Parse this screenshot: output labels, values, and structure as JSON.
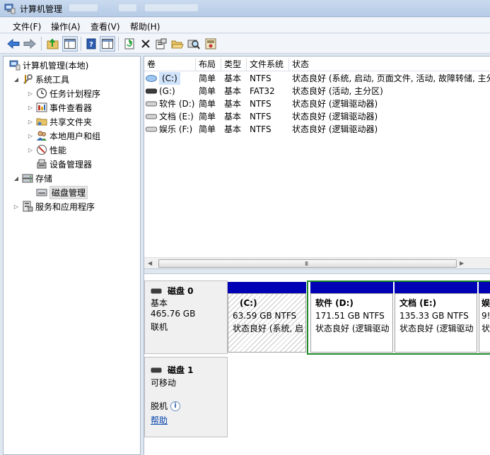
{
  "window": {
    "title": "计算机管理"
  },
  "menu": [
    {
      "label": "文件(F)"
    },
    {
      "label": "操作(A)"
    },
    {
      "label": "查看(V)"
    },
    {
      "label": "帮助(H)"
    }
  ],
  "toolbar": {
    "icons": [
      "back-arrow-icon",
      "forward-arrow-icon",
      "up-folder-icon",
      "show-hide-tree-icon",
      "help-book-icon",
      "show-hide-action-pane-icon",
      "refresh-icon",
      "delete-x-icon",
      "properties-icon",
      "open-folder-icon",
      "search-drive-icon",
      "disk-properties-icon"
    ]
  },
  "tree": {
    "root": "计算机管理(本地)",
    "system_tools": "系统工具",
    "task_scheduler": "任务计划程序",
    "event_viewer": "事件查看器",
    "shared_folders": "共享文件夹",
    "local_users": "本地用户和组",
    "performance": "性能",
    "device_manager": "设备管理器",
    "storage": "存储",
    "disk_management": "磁盘管理",
    "services_apps": "服务和应用程序"
  },
  "volumes": {
    "headers": [
      "卷",
      "布局",
      "类型",
      "文件系统",
      "状态"
    ],
    "rows": [
      {
        "name": "(C:)",
        "layout": "简单",
        "type": "基本",
        "fs": "NTFS",
        "status": "状态良好 (系统, 启动, 页面文件, 活动, 故障转储, 主分"
      },
      {
        "name": "(G:)",
        "layout": "简单",
        "type": "基本",
        "fs": "FAT32",
        "status": "状态良好 (活动, 主分区)"
      },
      {
        "name": "软件 (D:)",
        "layout": "简单",
        "type": "基本",
        "fs": "NTFS",
        "status": "状态良好 (逻辑驱动器)"
      },
      {
        "name": "文档 (E:)",
        "layout": "简单",
        "type": "基本",
        "fs": "NTFS",
        "status": "状态良好 (逻辑驱动器)"
      },
      {
        "name": "娱乐 (F:)",
        "layout": "简单",
        "type": "基本",
        "fs": "NTFS",
        "status": "状态良好 (逻辑驱动器)"
      }
    ],
    "scroll_grip": "III"
  },
  "disk0": {
    "title": "磁盘 0",
    "type": "基本",
    "size": "465.76 GB",
    "state": "联机",
    "partitions": [
      {
        "name": "(C:)",
        "size": "63.59 GB NTFS",
        "status": "状态良好 (系统, 启"
      },
      {
        "name": "软件  (D:)",
        "size": "171.51 GB NTFS",
        "status": "状态良好 (逻辑驱动"
      },
      {
        "name": "文档  (E:)",
        "size": "135.33 GB NTFS",
        "status": "状态良好 (逻辑驱动"
      },
      {
        "name": "娱",
        "size": "9!",
        "status": "状"
      }
    ]
  },
  "disk1": {
    "title": "磁盘 1",
    "type": "可移动",
    "state": "脱机",
    "help": "帮助"
  },
  "colors": {
    "primary_partition": "#0000b4",
    "extended_frame": "#1e8b28",
    "selection": "#cfe3fb"
  }
}
